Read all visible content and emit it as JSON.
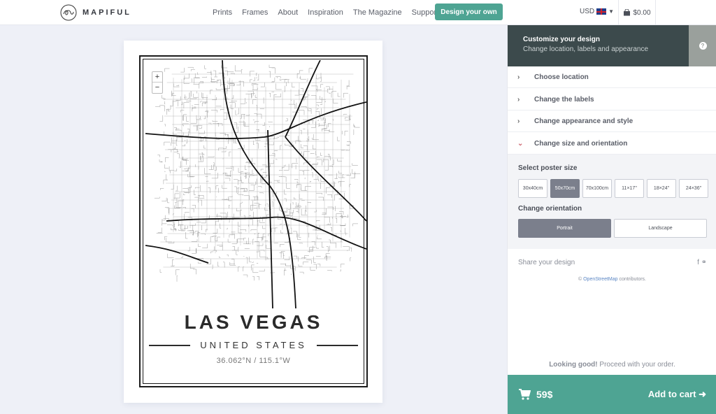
{
  "header": {
    "brand": "MAPIFUL",
    "nav": [
      "Prints",
      "Frames",
      "About",
      "Inspiration",
      "The Magazine",
      "Support"
    ],
    "cta": "Design your own",
    "currency": "USD",
    "cart_total": "$0.00"
  },
  "poster": {
    "city": "LAS VEGAS",
    "country": "UNITED STATES",
    "coords": "36.062°N / 115.1°W",
    "zoom_in": "+",
    "zoom_out": "−"
  },
  "panel": {
    "title": "Customize your design",
    "subtitle": "Change location, labels and appearance",
    "help": "?",
    "sections": [
      "Choose location",
      "Change the labels",
      "Change appearance and style",
      "Change size and orientation"
    ],
    "size_label": "Select poster size",
    "sizes": [
      "30x40cm",
      "50x70cm",
      "70x100cm",
      "11×17\"",
      "18×24\"",
      "24×36\""
    ],
    "selected_size": "50x70cm",
    "orientation_label": "Change orientation",
    "orientations": [
      "Portrait",
      "Landscape"
    ],
    "selected_orientation": "Portrait",
    "share": "Share your design",
    "share_icons": "f ⚭",
    "osm_prefix": "© ",
    "osm_link": "OpenStreetMap",
    "osm_suffix": " contributors.",
    "good_bold": "Looking good!",
    "good_rest": " Proceed with your order.",
    "price": "59$",
    "add_to_cart": "Add to cart ➜"
  },
  "colors": {
    "accent": "#4ea493",
    "panel_header": "#3c4a4c",
    "selected": "#7b7f8c"
  }
}
